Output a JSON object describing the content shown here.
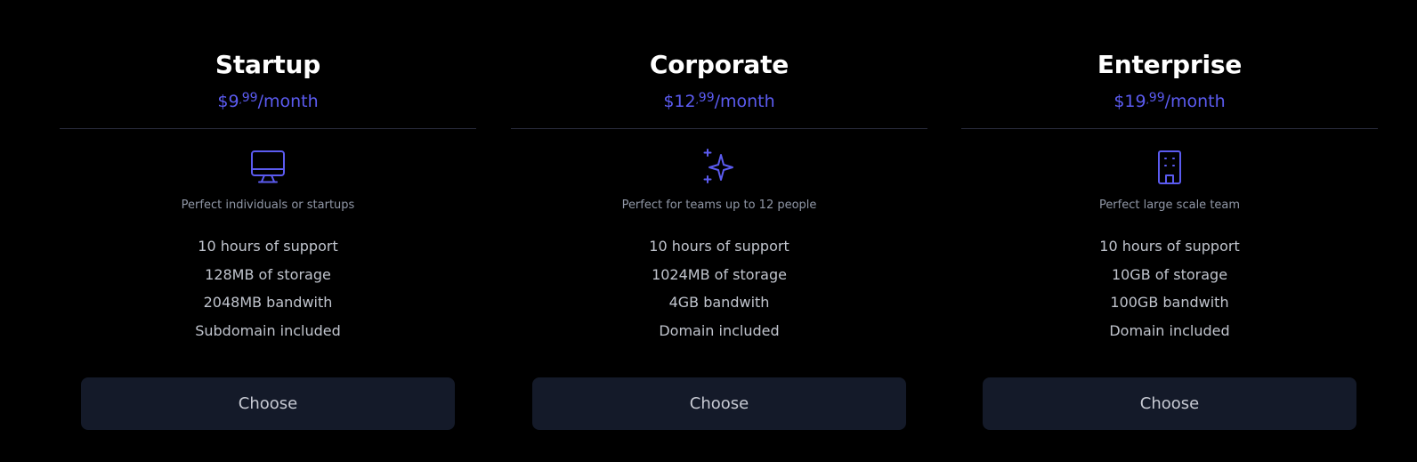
{
  "colors": {
    "background": "#000000",
    "accent": "#5b5bf0",
    "button_bg": "#141a29",
    "divider": "#2a2d3e"
  },
  "plans": [
    {
      "name": "Startup",
      "price": {
        "currency": "$",
        "dollars": "9",
        "separator": ",",
        "cents": "99",
        "period": "/month"
      },
      "icon": "monitor-icon",
      "description": "Perfect individuals or startups",
      "features": [
        "10 hours of support",
        "128MB of storage",
        "2048MB bandwith",
        "Subdomain included"
      ],
      "button_label": "Choose"
    },
    {
      "name": "Corporate",
      "price": {
        "currency": "$",
        "dollars": "12",
        "separator": ",",
        "cents": "99",
        "period": "/month"
      },
      "icon": "sparkles-icon",
      "description": "Perfect for teams up to 12 people",
      "features": [
        "10 hours of support",
        "1024MB of storage",
        "4GB bandwith",
        "Domain included"
      ],
      "button_label": "Choose"
    },
    {
      "name": "Enterprise",
      "price": {
        "currency": "$",
        "dollars": "19",
        "separator": ",",
        "cents": "99",
        "period": "/month"
      },
      "icon": "building-icon",
      "description": "Perfect large scale team",
      "features": [
        "10 hours of support",
        "10GB of storage",
        "100GB bandwith",
        "Domain included"
      ],
      "button_label": "Choose"
    }
  ]
}
